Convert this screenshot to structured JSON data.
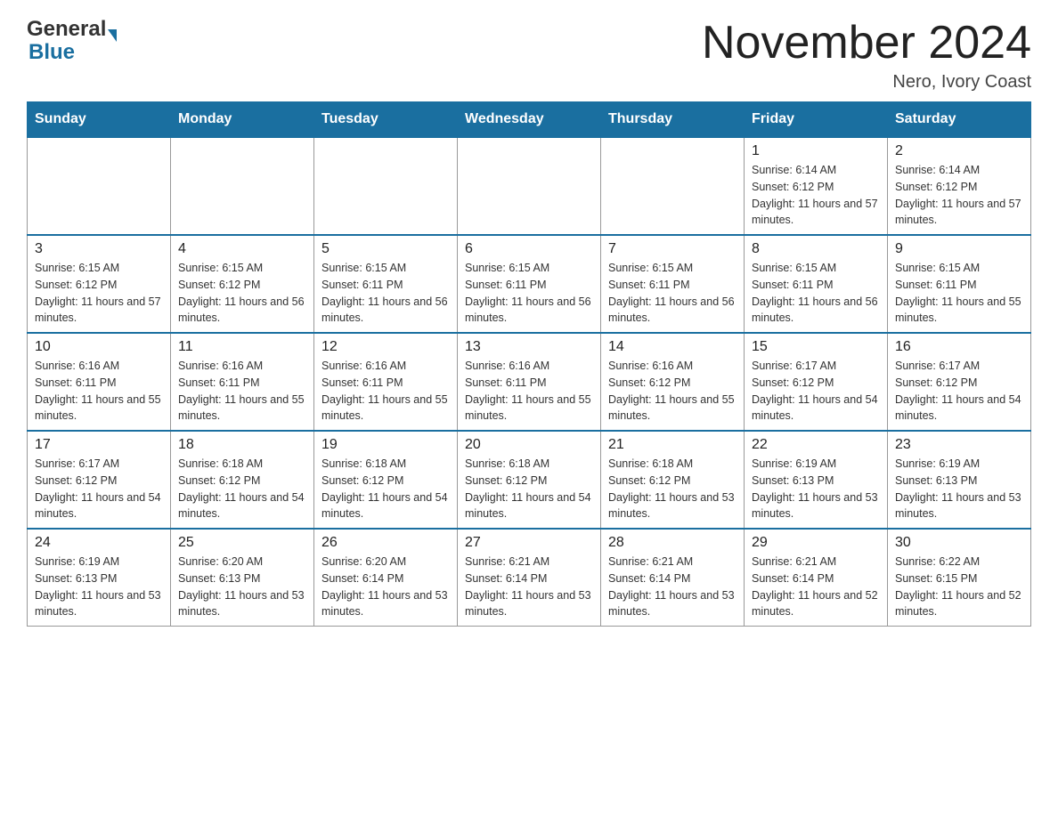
{
  "header": {
    "logo_general": "General",
    "logo_blue": "Blue",
    "month_title": "November 2024",
    "location": "Nero, Ivory Coast"
  },
  "weekdays": [
    "Sunday",
    "Monday",
    "Tuesday",
    "Wednesday",
    "Thursday",
    "Friday",
    "Saturday"
  ],
  "weeks": [
    [
      {
        "day": "",
        "sunrise": "",
        "sunset": "",
        "daylight": ""
      },
      {
        "day": "",
        "sunrise": "",
        "sunset": "",
        "daylight": ""
      },
      {
        "day": "",
        "sunrise": "",
        "sunset": "",
        "daylight": ""
      },
      {
        "day": "",
        "sunrise": "",
        "sunset": "",
        "daylight": ""
      },
      {
        "day": "",
        "sunrise": "",
        "sunset": "",
        "daylight": ""
      },
      {
        "day": "1",
        "sunrise": "Sunrise: 6:14 AM",
        "sunset": "Sunset: 6:12 PM",
        "daylight": "Daylight: 11 hours and 57 minutes."
      },
      {
        "day": "2",
        "sunrise": "Sunrise: 6:14 AM",
        "sunset": "Sunset: 6:12 PM",
        "daylight": "Daylight: 11 hours and 57 minutes."
      }
    ],
    [
      {
        "day": "3",
        "sunrise": "Sunrise: 6:15 AM",
        "sunset": "Sunset: 6:12 PM",
        "daylight": "Daylight: 11 hours and 57 minutes."
      },
      {
        "day": "4",
        "sunrise": "Sunrise: 6:15 AM",
        "sunset": "Sunset: 6:12 PM",
        "daylight": "Daylight: 11 hours and 56 minutes."
      },
      {
        "day": "5",
        "sunrise": "Sunrise: 6:15 AM",
        "sunset": "Sunset: 6:11 PM",
        "daylight": "Daylight: 11 hours and 56 minutes."
      },
      {
        "day": "6",
        "sunrise": "Sunrise: 6:15 AM",
        "sunset": "Sunset: 6:11 PM",
        "daylight": "Daylight: 11 hours and 56 minutes."
      },
      {
        "day": "7",
        "sunrise": "Sunrise: 6:15 AM",
        "sunset": "Sunset: 6:11 PM",
        "daylight": "Daylight: 11 hours and 56 minutes."
      },
      {
        "day": "8",
        "sunrise": "Sunrise: 6:15 AM",
        "sunset": "Sunset: 6:11 PM",
        "daylight": "Daylight: 11 hours and 56 minutes."
      },
      {
        "day": "9",
        "sunrise": "Sunrise: 6:15 AM",
        "sunset": "Sunset: 6:11 PM",
        "daylight": "Daylight: 11 hours and 55 minutes."
      }
    ],
    [
      {
        "day": "10",
        "sunrise": "Sunrise: 6:16 AM",
        "sunset": "Sunset: 6:11 PM",
        "daylight": "Daylight: 11 hours and 55 minutes."
      },
      {
        "day": "11",
        "sunrise": "Sunrise: 6:16 AM",
        "sunset": "Sunset: 6:11 PM",
        "daylight": "Daylight: 11 hours and 55 minutes."
      },
      {
        "day": "12",
        "sunrise": "Sunrise: 6:16 AM",
        "sunset": "Sunset: 6:11 PM",
        "daylight": "Daylight: 11 hours and 55 minutes."
      },
      {
        "day": "13",
        "sunrise": "Sunrise: 6:16 AM",
        "sunset": "Sunset: 6:11 PM",
        "daylight": "Daylight: 11 hours and 55 minutes."
      },
      {
        "day": "14",
        "sunrise": "Sunrise: 6:16 AM",
        "sunset": "Sunset: 6:12 PM",
        "daylight": "Daylight: 11 hours and 55 minutes."
      },
      {
        "day": "15",
        "sunrise": "Sunrise: 6:17 AM",
        "sunset": "Sunset: 6:12 PM",
        "daylight": "Daylight: 11 hours and 54 minutes."
      },
      {
        "day": "16",
        "sunrise": "Sunrise: 6:17 AM",
        "sunset": "Sunset: 6:12 PM",
        "daylight": "Daylight: 11 hours and 54 minutes."
      }
    ],
    [
      {
        "day": "17",
        "sunrise": "Sunrise: 6:17 AM",
        "sunset": "Sunset: 6:12 PM",
        "daylight": "Daylight: 11 hours and 54 minutes."
      },
      {
        "day": "18",
        "sunrise": "Sunrise: 6:18 AM",
        "sunset": "Sunset: 6:12 PM",
        "daylight": "Daylight: 11 hours and 54 minutes."
      },
      {
        "day": "19",
        "sunrise": "Sunrise: 6:18 AM",
        "sunset": "Sunset: 6:12 PM",
        "daylight": "Daylight: 11 hours and 54 minutes."
      },
      {
        "day": "20",
        "sunrise": "Sunrise: 6:18 AM",
        "sunset": "Sunset: 6:12 PM",
        "daylight": "Daylight: 11 hours and 54 minutes."
      },
      {
        "day": "21",
        "sunrise": "Sunrise: 6:18 AM",
        "sunset": "Sunset: 6:12 PM",
        "daylight": "Daylight: 11 hours and 53 minutes."
      },
      {
        "day": "22",
        "sunrise": "Sunrise: 6:19 AM",
        "sunset": "Sunset: 6:13 PM",
        "daylight": "Daylight: 11 hours and 53 minutes."
      },
      {
        "day": "23",
        "sunrise": "Sunrise: 6:19 AM",
        "sunset": "Sunset: 6:13 PM",
        "daylight": "Daylight: 11 hours and 53 minutes."
      }
    ],
    [
      {
        "day": "24",
        "sunrise": "Sunrise: 6:19 AM",
        "sunset": "Sunset: 6:13 PM",
        "daylight": "Daylight: 11 hours and 53 minutes."
      },
      {
        "day": "25",
        "sunrise": "Sunrise: 6:20 AM",
        "sunset": "Sunset: 6:13 PM",
        "daylight": "Daylight: 11 hours and 53 minutes."
      },
      {
        "day": "26",
        "sunrise": "Sunrise: 6:20 AM",
        "sunset": "Sunset: 6:14 PM",
        "daylight": "Daylight: 11 hours and 53 minutes."
      },
      {
        "day": "27",
        "sunrise": "Sunrise: 6:21 AM",
        "sunset": "Sunset: 6:14 PM",
        "daylight": "Daylight: 11 hours and 53 minutes."
      },
      {
        "day": "28",
        "sunrise": "Sunrise: 6:21 AM",
        "sunset": "Sunset: 6:14 PM",
        "daylight": "Daylight: 11 hours and 53 minutes."
      },
      {
        "day": "29",
        "sunrise": "Sunrise: 6:21 AM",
        "sunset": "Sunset: 6:14 PM",
        "daylight": "Daylight: 11 hours and 52 minutes."
      },
      {
        "day": "30",
        "sunrise": "Sunrise: 6:22 AM",
        "sunset": "Sunset: 6:15 PM",
        "daylight": "Daylight: 11 hours and 52 minutes."
      }
    ]
  ]
}
